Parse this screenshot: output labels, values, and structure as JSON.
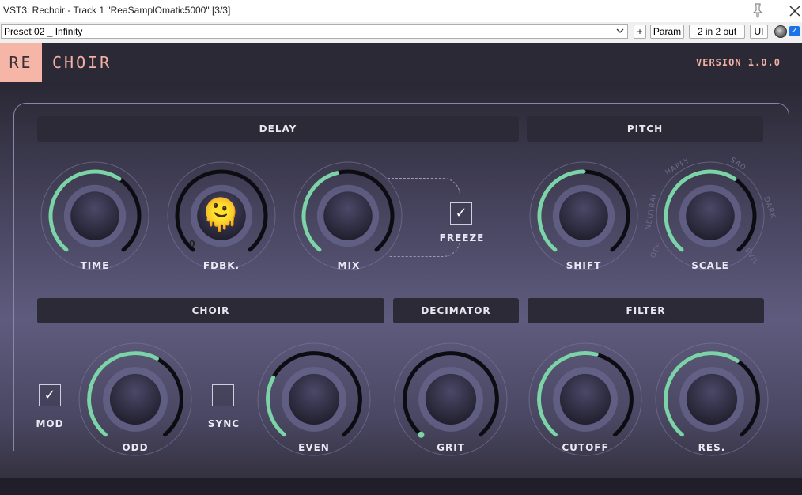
{
  "window": {
    "title": "VST3: Rechoir - Track 1 \"ReaSamplOmatic5000\" [3/3]"
  },
  "toolbar": {
    "preset": "Preset 02 _ Infinity",
    "plus": "+",
    "param": "Param",
    "io": "2 in 2 out",
    "ui": "UI",
    "check": "✓"
  },
  "header": {
    "logo_re": "RE",
    "logo_choir": "CHOIR",
    "version": "VERSION 1.0.0"
  },
  "sections": {
    "delay": "DELAY",
    "pitch": "PITCH",
    "choir": "CHOIR",
    "decimator": "DECIMATOR",
    "filter": "FILTER"
  },
  "knobs": {
    "time": {
      "label": "TIME",
      "value": 0.62
    },
    "fdbk": {
      "label": "FDBK.",
      "value": 0.0,
      "readout": "0"
    },
    "mix": {
      "label": "MIX",
      "value": 0.45
    },
    "shift": {
      "label": "SHIFT",
      "value": 0.5
    },
    "scale": {
      "label": "SCALE",
      "value": 0.62
    },
    "odd": {
      "label": "ODD",
      "value": 0.6
    },
    "even": {
      "label": "EVEN",
      "value": 0.28
    },
    "grit": {
      "label": "GRIT",
      "value": 0.0
    },
    "cutoff": {
      "label": "CUTOFF",
      "value": 0.55
    },
    "res": {
      "label": "RES.",
      "value": 0.62
    }
  },
  "toggles": {
    "freeze": {
      "label": "FREEZE",
      "checked": true,
      "mark": "✓"
    },
    "mod": {
      "label": "MOD",
      "checked": true,
      "mark": "✓"
    },
    "sync": {
      "label": "SYNC",
      "checked": false,
      "mark": ""
    }
  },
  "scale_words": [
    "OFF",
    "NEUTRAL",
    "HAPPY",
    "SAD",
    "DARK",
    "EVIL"
  ],
  "emoji": "🫠",
  "colors": {
    "accent": "#7dd3a8",
    "track": "#0d0c12",
    "logo": "#f5b6a8"
  }
}
